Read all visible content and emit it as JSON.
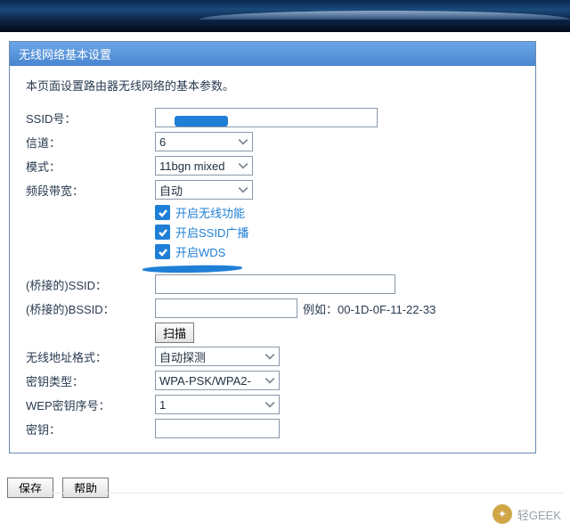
{
  "panel": {
    "title": "无线网络基本设置"
  },
  "desc": "本页面设置路由器无线网络的基本参数。",
  "fields": {
    "ssid_label": "SSID号：",
    "ssid_value": "",
    "channel_label": "信道：",
    "channel_value": "6",
    "mode_label": "模式：",
    "mode_value": "11bgn mixed",
    "bandwidth_label": "频段带宽：",
    "bandwidth_value": "自动",
    "bridge_ssid_label": "(桥接的)SSID：",
    "bridge_ssid_value": "",
    "bridge_bssid_label": "(桥接的)BSSID：",
    "bridge_bssid_value": "",
    "bssid_example": "例如：00-1D-0F-11-22-33",
    "scan_btn": "扫描",
    "addr_fmt_label": "无线地址格式：",
    "addr_fmt_value": "自动探测",
    "key_type_label": "密钥类型：",
    "key_type_value": "WPA-PSK/WPA2-",
    "wep_idx_label": "WEP密钥序号：",
    "wep_idx_value": "1",
    "key_label": "密钥："
  },
  "checks": {
    "wireless": "开启无线功能",
    "broadcast": "开启SSID广播",
    "wds": "开启WDS"
  },
  "bottom": {
    "save": "保存",
    "help": "帮助"
  },
  "watermark": "轻GEEK"
}
